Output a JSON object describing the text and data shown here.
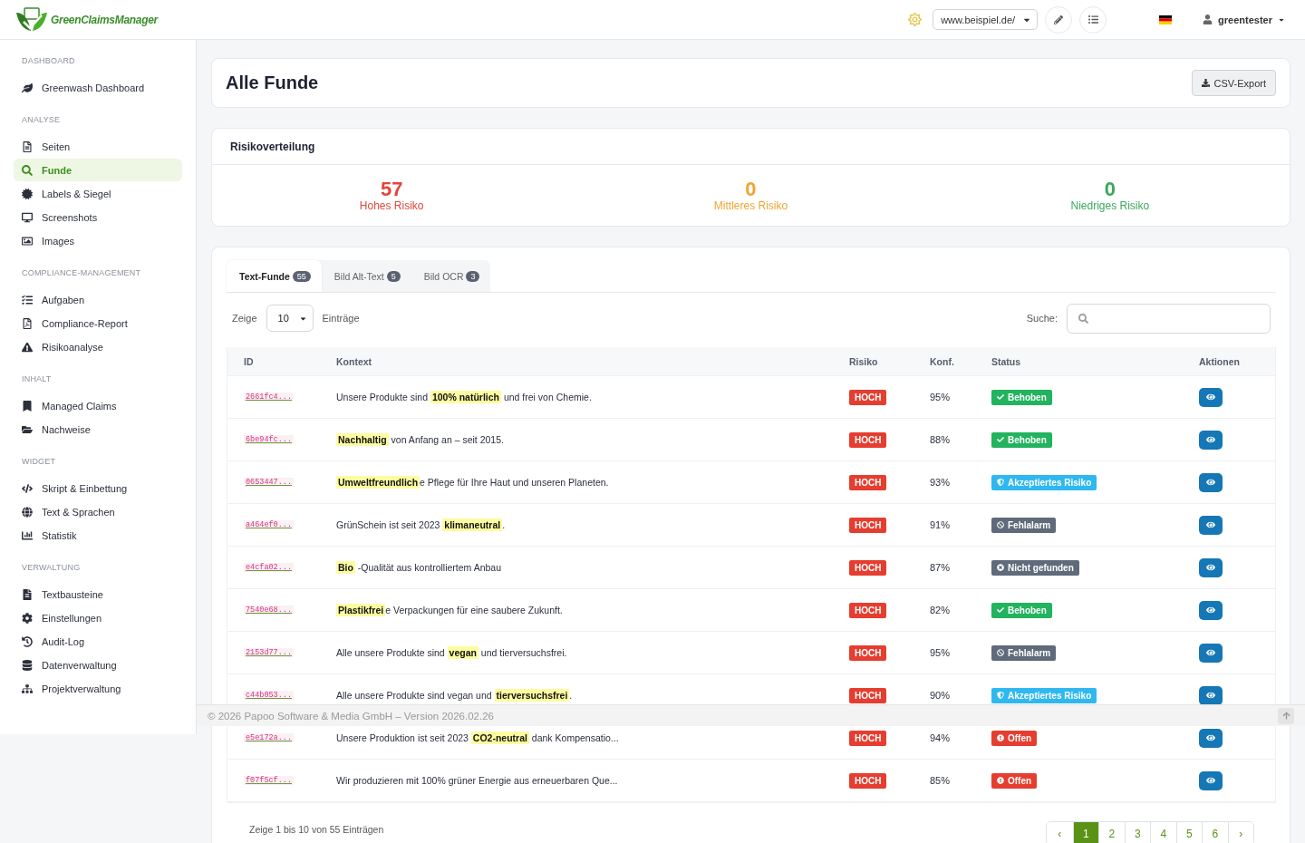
{
  "header": {
    "logo": "GreenClaimsManager",
    "site_select": "www.beispiel.de/",
    "user": "greentester"
  },
  "sidebar": {
    "sections": [
      {
        "title": "DASHBOARD",
        "items": [
          {
            "label": "Greenwash Dashboard",
            "selected": false
          }
        ]
      },
      {
        "title": "ANALYSE",
        "items": [
          {
            "label": "Seiten",
            "selected": false
          },
          {
            "label": "Funde",
            "selected": true
          },
          {
            "label": "Labels & Siegel",
            "selected": false
          },
          {
            "label": "Screenshots",
            "selected": false
          },
          {
            "label": "Images",
            "selected": false
          }
        ]
      },
      {
        "title": "COMPLIANCE-MANAGEMENT",
        "items": [
          {
            "label": "Aufgaben",
            "selected": false
          },
          {
            "label": "Compliance-Report",
            "selected": false
          },
          {
            "label": "Risikoanalyse",
            "selected": false
          }
        ]
      },
      {
        "title": "INHALT",
        "items": [
          {
            "label": "Managed Claims",
            "selected": false
          },
          {
            "label": "Nachweise",
            "selected": false
          }
        ]
      },
      {
        "title": "WIDGET",
        "items": [
          {
            "label": "Skript & Einbettung",
            "selected": false
          },
          {
            "label": "Text & Sprachen",
            "selected": false
          },
          {
            "label": "Statistik",
            "selected": false
          }
        ]
      },
      {
        "title": "VERWALTUNG",
        "items": [
          {
            "label": "Textbausteine",
            "selected": false
          },
          {
            "label": "Einstellungen",
            "selected": false
          },
          {
            "label": "Audit-Log",
            "selected": false
          },
          {
            "label": "Datenverwaltung",
            "selected": false
          },
          {
            "label": "Projektverwaltung",
            "selected": false
          }
        ]
      }
    ]
  },
  "page": {
    "title": "Alle Funde",
    "export_button": "CSV-Export"
  },
  "risk_distribution": {
    "title": "Risikoverteilung",
    "items": [
      {
        "value": "57",
        "label": "Hohes Risiko",
        "color": "#e0463a"
      },
      {
        "value": "0",
        "label": "Mittleres Risiko",
        "color": "#f0a533"
      },
      {
        "value": "0",
        "label": "Niedriges Risiko",
        "color": "#3aa85c"
      }
    ]
  },
  "tabs": [
    {
      "label": "Text-Funde",
      "count": "55",
      "selected": true
    },
    {
      "label": "Bild Alt-Text",
      "count": "5",
      "selected": false
    },
    {
      "label": "Bild OCR",
      "count": "3",
      "selected": false
    }
  ],
  "length_control": {
    "before": "Zeige",
    "value": "10",
    "after": "Einträge"
  },
  "search": {
    "label": "Suche:"
  },
  "table": {
    "columns": [
      "ID",
      "Kontext",
      "Risiko",
      "Konf.",
      "Status",
      "Aktionen"
    ],
    "rows": [
      {
        "id": "2661fc4...",
        "context": "Unsere Produkte sind **100% natürlich** und frei von Chemie.",
        "risk": "HOCH",
        "confidence": "95%",
        "status": {
          "label": "Behoben",
          "kind": "fixed"
        }
      },
      {
        "id": "6be94fc...",
        "context": "**Nachhaltig** von Anfang an – seit 2015.",
        "risk": "HOCH",
        "confidence": "88%",
        "status": {
          "label": "Behoben",
          "kind": "fixed"
        }
      },
      {
        "id": "0653447...",
        "context": "**Umweltfreundlich**e Pflege für Ihre Haut und unseren Planeten.",
        "risk": "HOCH",
        "confidence": "93%",
        "status": {
          "label": "Akzeptiertes Risiko",
          "kind": "accepted"
        }
      },
      {
        "id": "a464ef0...",
        "context": "GrünSchein ist seit 2023 **klimaneutral**.",
        "risk": "HOCH",
        "confidence": "91%",
        "status": {
          "label": "Fehlalarm",
          "kind": "false_alarm"
        }
      },
      {
        "id": "e4cfa02...",
        "context": "**Bio** -Qualität aus kontrolliertem Anbau",
        "risk": "HOCH",
        "confidence": "87%",
        "status": {
          "label": "Nicht gefunden",
          "kind": "not_found"
        }
      },
      {
        "id": "7540e68...",
        "context": "**Plastikfrei**e Verpackungen für eine saubere Zukunft.",
        "risk": "HOCH",
        "confidence": "82%",
        "status": {
          "label": "Behoben",
          "kind": "fixed"
        }
      },
      {
        "id": "2153d77...",
        "context": "Alle unsere Produkte sind **vegan** und tierversuchsfrei.",
        "risk": "HOCH",
        "confidence": "95%",
        "status": {
          "label": "Fehlalarm",
          "kind": "false_alarm"
        }
      },
      {
        "id": "c44b053...",
        "context": "Alle unsere Produkte sind vegan und **tierversuchsfrei**.",
        "risk": "HOCH",
        "confidence": "90%",
        "status": {
          "label": "Akzeptiertes Risiko",
          "kind": "accepted"
        }
      },
      {
        "id": "e5e172a...",
        "context": "Unsere Produktion ist seit 2023 **CO2-neutral** dank Kompensatio...",
        "risk": "HOCH",
        "confidence": "94%",
        "status": {
          "label": "Offen",
          "kind": "open"
        }
      },
      {
        "id": "f07f5cf...",
        "context": "Wir produzieren mit 100% grüner Energie aus erneuerbaren Que...",
        "risk": "HOCH",
        "confidence": "85%",
        "status": {
          "label": "Offen",
          "kind": "open"
        }
      }
    ]
  },
  "table_info": "Zeige 1 bis 10 von 55 Einträgen",
  "pagination": [
    {
      "label": "‹",
      "selected": false
    },
    {
      "label": "1",
      "selected": true
    },
    {
      "label": "2",
      "selected": false
    },
    {
      "label": "3",
      "selected": false
    },
    {
      "label": "4",
      "selected": false
    },
    {
      "label": "5",
      "selected": false
    },
    {
      "label": "6",
      "selected": false
    },
    {
      "label": "›",
      "selected": false
    }
  ],
  "footer": "© 2026 Papoo Software & Media GmbH – Version 2026.02.26"
}
